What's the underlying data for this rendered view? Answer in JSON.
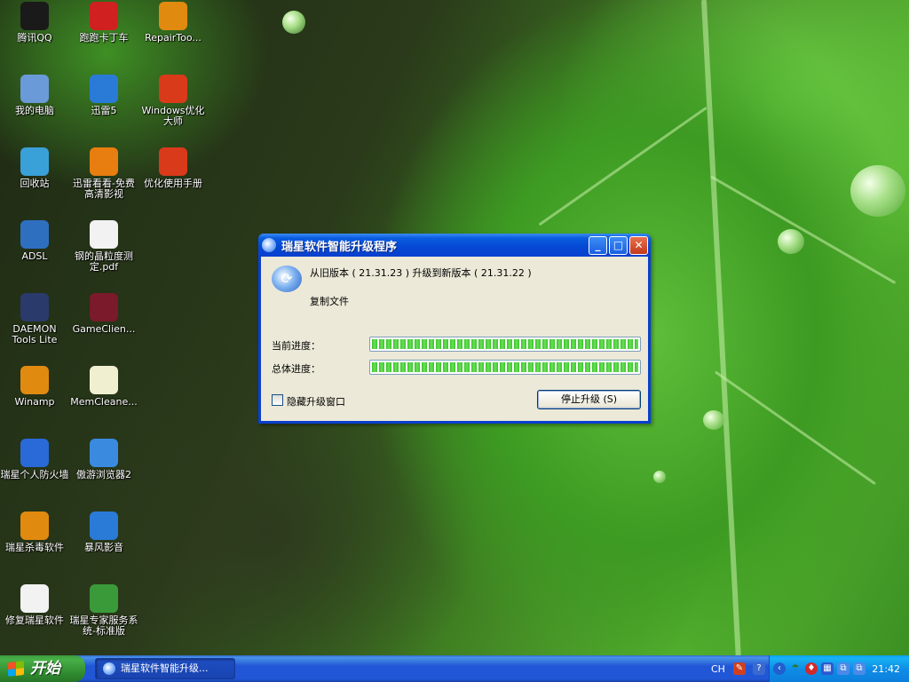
{
  "desktop": {
    "icons": [
      {
        "label": "腾讯QQ",
        "icon": "qq-penguin-icon",
        "color": "#1a1a1a"
      },
      {
        "label": "跑跑卡丁车",
        "icon": "kart-game-icon",
        "color": "#d02020"
      },
      {
        "label": "RepairToo...",
        "icon": "rising-lion-shield-icon",
        "color": "#e08a10"
      },
      {
        "label": "我的电脑",
        "icon": "my-computer-icon",
        "color": "#6a9ad8"
      },
      {
        "label": "迅雷5",
        "icon": "thunder-icon",
        "color": "#2a7ad8"
      },
      {
        "label": "Windows优化大师",
        "icon": "windows-optimizer-icon",
        "color": "#d83a1a"
      },
      {
        "label": "回收站",
        "icon": "recycle-bin-icon",
        "color": "#3aa0d8"
      },
      {
        "label": "迅雷看看-免费高清影视",
        "icon": "xunlei-kankan-icon",
        "color": "#e87d10"
      },
      {
        "label": "优化使用手册",
        "icon": "manual-icon",
        "color": "#d83a1a"
      },
      {
        "label": "ADSL",
        "icon": "network-icon",
        "color": "#2f6fc0"
      },
      {
        "label": "钢的晶粒度测定.pdf",
        "icon": "pdf-file-icon",
        "color": "#f2f2f2"
      },
      {
        "label": "DAEMON Tools Lite",
        "icon": "daemon-tools-icon",
        "color": "#2a3a6a"
      },
      {
        "label": "GameClien...",
        "icon": "game-client-icon",
        "color": "#7a1a2a"
      },
      {
        "label": "Winamp",
        "icon": "winamp-icon",
        "color": "#e08a10"
      },
      {
        "label": "MemCleane...",
        "icon": "mem-cleaner-icon",
        "color": "#f0f0d0"
      },
      {
        "label": "瑞星个人防火墙",
        "icon": "firewall-icon",
        "color": "#2a6ad8"
      },
      {
        "label": "傲游浏览器2",
        "icon": "maxthon-browser-icon",
        "color": "#3a8ae0"
      },
      {
        "label": "瑞星杀毒软件",
        "icon": "rising-antivirus-icon",
        "color": "#e08a10"
      },
      {
        "label": "暴风影音",
        "icon": "storm-player-icon",
        "color": "#2a7ad8"
      },
      {
        "label": "修复瑞星软件",
        "icon": "repair-file-icon",
        "color": "#f2f2f2"
      },
      {
        "label": "瑞星专家服务系统-标准版",
        "icon": "expert-service-icon",
        "color": "#3a9a3a"
      }
    ]
  },
  "dialog": {
    "title": "瑞星软件智能升级程序",
    "version_text": "从旧版本 ( 21.31.23 ) 升级到新版本 ( 21.31.22 )",
    "status_text": "复制文件",
    "current_label": "当前进度：",
    "total_label": "总体进度：",
    "current_progress": 1.0,
    "total_progress": 1.0,
    "hide_label": "隐藏升级窗口",
    "hide_checked": false,
    "stop_button": "停止升级 (S)",
    "minimize": "_",
    "maximize": "□",
    "close": "✕"
  },
  "taskbar": {
    "start_label": "开始",
    "task_label": "瑞星软件智能升级...",
    "lang": "CH",
    "clock": "21:42",
    "tray_icons": [
      "input-method-icon",
      "help-icon",
      "show-hidden-icon",
      "umbrella-icon",
      "rising-shield-icon",
      "firewall-tray-icon",
      "network-tray-icon"
    ]
  },
  "colors": {
    "titlebar": "#0a3fcf",
    "taskbar": "#2157d7",
    "start": "#3c9a3c",
    "progress": "#3bc22a"
  }
}
